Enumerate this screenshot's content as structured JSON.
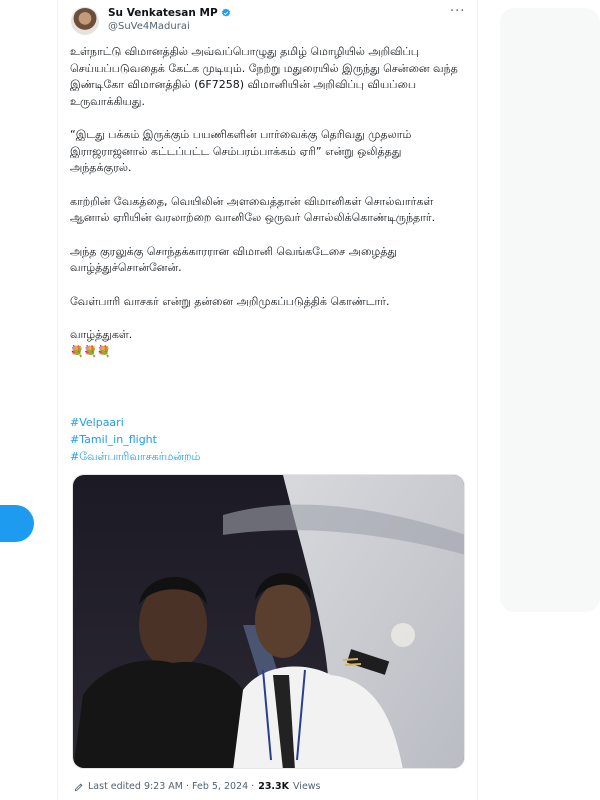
{
  "tweet": {
    "author_name": "Su Venkatesan MP",
    "author_handle": "@SuVe4Madurai",
    "more_label": "···",
    "paragraphs": [
      "உள்நாட்டு விமானத்தில் அவ்வப்பொழுது தமிழ் மொழியில் அறிவிப்பு செய்யப்படுவதைக் கேட்க முடியும். நேற்று மதுரையில் இருந்து சென்னை வந்த இண்டிகோ விமானத்தில் (6F7258) விமானியின் அறிவிப்பு வியப்பை உருவாக்கியது.",
      "“இடது பக்கம் இருக்கும் பயணிகளின் பார்வைக்கு தெரிவது முதலாம் இராஜராஜனால் கட்டப்பட்ட செம்பரம்பாக்கம் ஏரி” என்று ஒலித்தது அந்தக்குரல்.",
      "காற்றின் வேகத்தை, வெயிலின் அளவைத்தான் விமானிகள் சொல்வார்கள் ஆனால் ஏரியின் வரலாற்றை வானிலே ஒருவர் சொல்லிக்கொண்டிருந்தார்.",
      "அந்த குரலுக்கு சொந்தக்காரரான விமானி வெங்கடேசை அழைத்து வாழ்த்துச்சொன்னேன்.",
      "வேள்பாரி வாசகர் என்று தன்னை அறிமுகப்படுத்திக் கொண்டார்."
    ],
    "closing": "வாழ்த்துகள்.",
    "emoji": "💐💐💐",
    "hashtags": [
      "#Velpaari",
      "#Tamil_in_flight",
      "#வேள்பாரிவாசகர்மன்றம்"
    ],
    "meta": {
      "edited": "Last edited 9:23 AM · Feb 5, 2024 · ",
      "views_count": "23.3K",
      "views_label": "Views"
    }
  },
  "colors": {
    "accent": "#1d9bf0",
    "text": "#0f1419",
    "secondary": "#536471"
  }
}
